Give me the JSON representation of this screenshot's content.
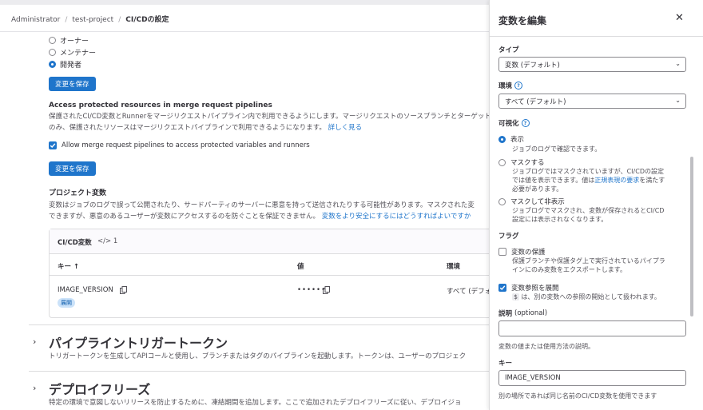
{
  "breadcrumb": [
    "Administrator",
    "test-project",
    "CI/CDの設定"
  ],
  "roles": {
    "options": [
      "オーナー",
      "メンテナー",
      "開発者"
    ],
    "save_label": "変更を保存"
  },
  "access": {
    "title": "Access protected resources in merge request pipelines",
    "desc1": "保護されたCI/CD変数とRunnerをマージリクエストパイプライン内で利用できるようにします。マージリクエストのソースブランチとターゲットブランチ",
    "desc2": "のみ、保護されたリソースはマージリクエストパイプラインで利用できるようになります。",
    "learn_more": "詳しく見る",
    "checkbox_label": "Allow merge request pipelines to access protected variables and runners",
    "save_label": "変更を保存"
  },
  "project_vars": {
    "title": "プロジェクト変数",
    "desc1": "変数はジョブのログで誤って公開されたり、サードパーティのサーバーに悪意を持って送信されたりする可能性があります。マスクされた変",
    "desc2": "できますが、悪意のあるユーザーが変数にアクセスするのを防ぐことを保証できません。",
    "link": "変数をより安全にするにはどうすればよいですか",
    "card_title": "CI/CD変数",
    "count": "1",
    "col_key": "キー ↑",
    "col_value": "値",
    "col_env": "環境",
    "row": {
      "key": "IMAGE_VERSION",
      "badge": "展開",
      "value": "••••••",
      "env": "すべて (デフォ"
    }
  },
  "trigger": {
    "title": "パイプライントリガートークン",
    "desc": "トリガートークンを生成してAPIコールと使用し、ブランチまたはタグのパイプラインを起動します。トークンは、ユーザーのプロジェク"
  },
  "freeze": {
    "title": "デプロイフリーズ",
    "desc": "特定の環境で意図しないリリースを防止するために、凍結期間を追加します。ここで追加されたデプロイフリーズに従い、デプロイジョ"
  },
  "drawer": {
    "title": "変数を編集",
    "type_label": "タイプ",
    "type_value": "変数 (デフォルト)",
    "env_label": "環境",
    "env_value": "すべて (デフォルト)",
    "visibility_label": "可視化",
    "vis_show": "表示",
    "vis_show_desc": "ジョブのログで確認できます。",
    "vis_mask": "マスクする",
    "vis_mask_desc1": "ジョブログではマスクされていますが、CI/CDの設定",
    "vis_mask_desc2": "では値を表示できます。値は",
    "vis_mask_link": "正規表現の要求",
    "vis_mask_desc3": "を満たす",
    "vis_mask_desc4": "必要があります。",
    "vis_hidden": "マスクして非表示",
    "vis_hidden_desc1": "ジョブログでマスクされ、変数が保存されるとCI/CD",
    "vis_hidden_desc2": "設定には表示されなくなります。",
    "flags_label": "フラグ",
    "protect_label": "変数の保護",
    "protect_desc1": "保護ブランチや保護タグ上で実行されているパイプラ",
    "protect_desc2": "インにのみ変数をエクスポートします。",
    "expand_label": "変数参照を展開",
    "expand_code": "$",
    "expand_desc": "は、別の変数への参照の開始として扱われます。",
    "desc_label": "説明",
    "desc_optional": "(optional)",
    "desc_value": "",
    "desc_help": "変数の値または使用方法の説明。",
    "key_label": "キー",
    "key_value": "IMAGE_VERSION",
    "key_help": "別の場所であれば同じ名前のCI/CD変数を使用できます"
  }
}
